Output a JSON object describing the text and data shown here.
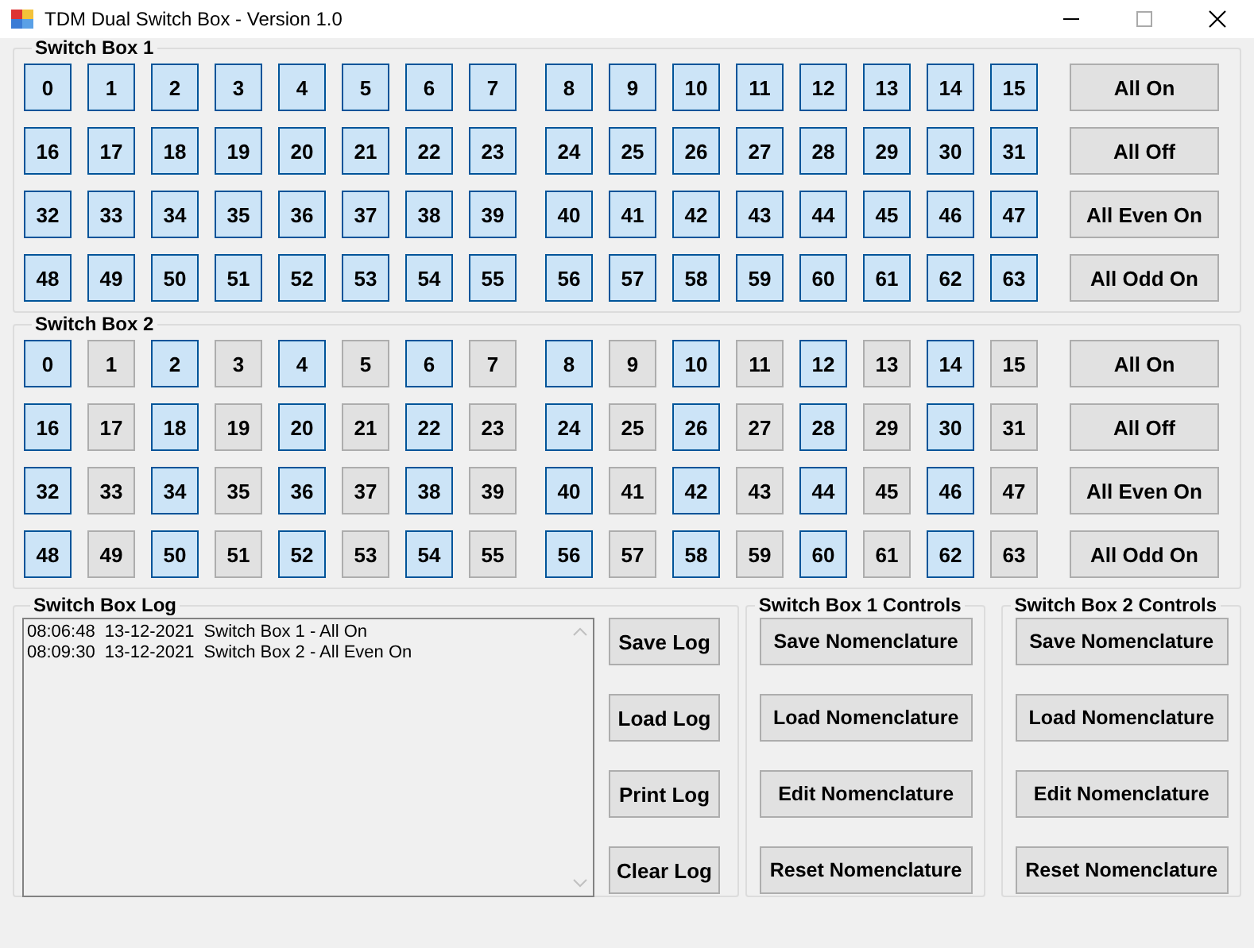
{
  "window": {
    "title": "TDM Dual Switch Box - Version 1.0"
  },
  "switch_boxes": [
    {
      "title": "Switch Box 1",
      "switches": [
        {
          "label": "0",
          "on": true
        },
        {
          "label": "1",
          "on": true
        },
        {
          "label": "2",
          "on": true
        },
        {
          "label": "3",
          "on": true
        },
        {
          "label": "4",
          "on": true
        },
        {
          "label": "5",
          "on": true
        },
        {
          "label": "6",
          "on": true
        },
        {
          "label": "7",
          "on": true
        },
        {
          "label": "8",
          "on": true
        },
        {
          "label": "9",
          "on": true
        },
        {
          "label": "10",
          "on": true
        },
        {
          "label": "11",
          "on": true
        },
        {
          "label": "12",
          "on": true
        },
        {
          "label": "13",
          "on": true
        },
        {
          "label": "14",
          "on": true
        },
        {
          "label": "15",
          "on": true
        },
        {
          "label": "16",
          "on": true
        },
        {
          "label": "17",
          "on": true
        },
        {
          "label": "18",
          "on": true
        },
        {
          "label": "19",
          "on": true
        },
        {
          "label": "20",
          "on": true
        },
        {
          "label": "21",
          "on": true
        },
        {
          "label": "22",
          "on": true
        },
        {
          "label": "23",
          "on": true
        },
        {
          "label": "24",
          "on": true
        },
        {
          "label": "25",
          "on": true
        },
        {
          "label": "26",
          "on": true
        },
        {
          "label": "27",
          "on": true
        },
        {
          "label": "28",
          "on": true
        },
        {
          "label": "29",
          "on": true
        },
        {
          "label": "30",
          "on": true
        },
        {
          "label": "31",
          "on": true
        },
        {
          "label": "32",
          "on": true
        },
        {
          "label": "33",
          "on": true
        },
        {
          "label": "34",
          "on": true
        },
        {
          "label": "35",
          "on": true
        },
        {
          "label": "36",
          "on": true
        },
        {
          "label": "37",
          "on": true
        },
        {
          "label": "38",
          "on": true
        },
        {
          "label": "39",
          "on": true
        },
        {
          "label": "40",
          "on": true
        },
        {
          "label": "41",
          "on": true
        },
        {
          "label": "42",
          "on": true
        },
        {
          "label": "43",
          "on": true
        },
        {
          "label": "44",
          "on": true
        },
        {
          "label": "45",
          "on": true
        },
        {
          "label": "46",
          "on": true
        },
        {
          "label": "47",
          "on": true
        },
        {
          "label": "48",
          "on": true
        },
        {
          "label": "49",
          "on": true
        },
        {
          "label": "50",
          "on": true
        },
        {
          "label": "51",
          "on": true
        },
        {
          "label": "52",
          "on": true
        },
        {
          "label": "53",
          "on": true
        },
        {
          "label": "54",
          "on": true
        },
        {
          "label": "55",
          "on": true
        },
        {
          "label": "56",
          "on": true
        },
        {
          "label": "57",
          "on": true
        },
        {
          "label": "58",
          "on": true
        },
        {
          "label": "59",
          "on": true
        },
        {
          "label": "60",
          "on": true
        },
        {
          "label": "61",
          "on": true
        },
        {
          "label": "62",
          "on": true
        },
        {
          "label": "63",
          "on": true
        }
      ],
      "buttons": [
        "All On",
        "All Off",
        "All Even On",
        "All Odd On"
      ]
    },
    {
      "title": "Switch Box 2",
      "switches": [
        {
          "label": "0",
          "on": true
        },
        {
          "label": "1",
          "on": false
        },
        {
          "label": "2",
          "on": true
        },
        {
          "label": "3",
          "on": false
        },
        {
          "label": "4",
          "on": true
        },
        {
          "label": "5",
          "on": false
        },
        {
          "label": "6",
          "on": true
        },
        {
          "label": "7",
          "on": false
        },
        {
          "label": "8",
          "on": true
        },
        {
          "label": "9",
          "on": false
        },
        {
          "label": "10",
          "on": true
        },
        {
          "label": "11",
          "on": false
        },
        {
          "label": "12",
          "on": true
        },
        {
          "label": "13",
          "on": false
        },
        {
          "label": "14",
          "on": true
        },
        {
          "label": "15",
          "on": false
        },
        {
          "label": "16",
          "on": true
        },
        {
          "label": "17",
          "on": false
        },
        {
          "label": "18",
          "on": true
        },
        {
          "label": "19",
          "on": false
        },
        {
          "label": "20",
          "on": true
        },
        {
          "label": "21",
          "on": false
        },
        {
          "label": "22",
          "on": true
        },
        {
          "label": "23",
          "on": false
        },
        {
          "label": "24",
          "on": true
        },
        {
          "label": "25",
          "on": false
        },
        {
          "label": "26",
          "on": true
        },
        {
          "label": "27",
          "on": false
        },
        {
          "label": "28",
          "on": true
        },
        {
          "label": "29",
          "on": false
        },
        {
          "label": "30",
          "on": true
        },
        {
          "label": "31",
          "on": false
        },
        {
          "label": "32",
          "on": true
        },
        {
          "label": "33",
          "on": false
        },
        {
          "label": "34",
          "on": true
        },
        {
          "label": "35",
          "on": false
        },
        {
          "label": "36",
          "on": true
        },
        {
          "label": "37",
          "on": false
        },
        {
          "label": "38",
          "on": true
        },
        {
          "label": "39",
          "on": false
        },
        {
          "label": "40",
          "on": true
        },
        {
          "label": "41",
          "on": false
        },
        {
          "label": "42",
          "on": true
        },
        {
          "label": "43",
          "on": false
        },
        {
          "label": "44",
          "on": true
        },
        {
          "label": "45",
          "on": false
        },
        {
          "label": "46",
          "on": true
        },
        {
          "label": "47",
          "on": false
        },
        {
          "label": "48",
          "on": true
        },
        {
          "label": "49",
          "on": false
        },
        {
          "label": "50",
          "on": true
        },
        {
          "label": "51",
          "on": false
        },
        {
          "label": "52",
          "on": true
        },
        {
          "label": "53",
          "on": false
        },
        {
          "label": "54",
          "on": true
        },
        {
          "label": "55",
          "on": false
        },
        {
          "label": "56",
          "on": true
        },
        {
          "label": "57",
          "on": false
        },
        {
          "label": "58",
          "on": true
        },
        {
          "label": "59",
          "on": false
        },
        {
          "label": "60",
          "on": true
        },
        {
          "label": "61",
          "on": false
        },
        {
          "label": "62",
          "on": true
        },
        {
          "label": "63",
          "on": false
        }
      ],
      "buttons": [
        "All On",
        "All Off",
        "All Even On",
        "All Odd On"
      ]
    }
  ],
  "log": {
    "title": "Switch Box Log",
    "entries": [
      "08:06:48  13-12-2021  Switch Box 1 - All On",
      "08:09:30  13-12-2021  Switch Box 2 - All Even On"
    ],
    "buttons": [
      "Save Log",
      "Load Log",
      "Print Log",
      "Clear Log"
    ]
  },
  "controls": [
    {
      "title": "Switch Box 1 Controls",
      "buttons": [
        "Save Nomenclature",
        "Load Nomenclature",
        "Edit Nomenclature",
        "Reset Nomenclature"
      ]
    },
    {
      "title": "Switch Box 2 Controls",
      "buttons": [
        "Save Nomenclature",
        "Load Nomenclature",
        "Edit Nomenclature",
        "Reset Nomenclature"
      ]
    }
  ]
}
